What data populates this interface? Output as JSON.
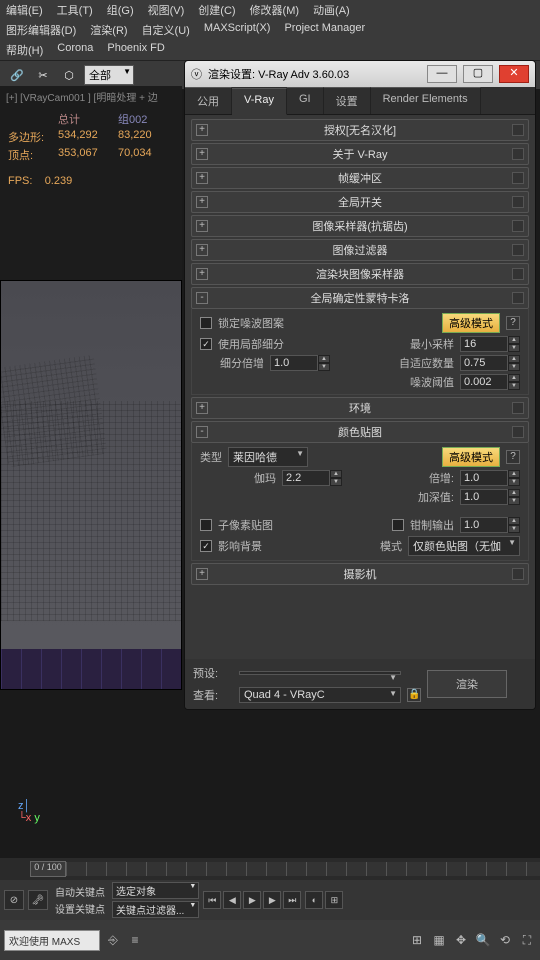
{
  "menu": {
    "row1": [
      "编辑(E)",
      "工具(T)",
      "组(G)",
      "视图(V)",
      "创建(C)",
      "修改器(M)",
      "动画(A)"
    ],
    "row2": [
      "图形编辑器(D)",
      "渲染(R)",
      "自定义(U)",
      "MAXScript(X)",
      "Project Manager"
    ],
    "row3": [
      "帮助(H)",
      "Corona",
      "Phoenix FD"
    ]
  },
  "toolbar": {
    "dropdown": "全部"
  },
  "viewport": {
    "cam": "[+] [VRayCam001 ] [明暗处理 + 边",
    "stats": {
      "h_total": "总计",
      "h_sub": "组002",
      "poly_lab": "多边形:",
      "poly_t": "534,292",
      "poly_s": "83,220",
      "vert_lab": "顶点:",
      "vert_t": "353,067",
      "vert_s": "70,034"
    },
    "fps_lab": "FPS:",
    "fps_val": "0.239"
  },
  "dialog": {
    "title": "渲染设置: V-Ray Adv 3.60.03",
    "tabs": [
      "公用",
      "V-Ray",
      "GI",
      "设置",
      "Render Elements"
    ],
    "active_tab": 1,
    "rollouts_collapsed": [
      "授权[无名汉化]",
      "关于 V-Ray",
      "帧缓冲区",
      "全局开关",
      "图像采样器(抗锯齿)",
      "图像过滤器",
      "渲染块图像采样器"
    ],
    "dmc": {
      "title": "全局确定性蒙特卡洛",
      "lock": "锁定噪波图案",
      "adv_btn": "高级模式",
      "use_local": "使用局部细分",
      "min_lab": "最小采样",
      "min_val": "16",
      "subdiv_lab": "细分倍增",
      "subdiv_val": "1.0",
      "adapt_lab": "自适应数量",
      "adapt_val": "0.75",
      "noise_lab": "噪波阈值",
      "noise_val": "0.002"
    },
    "env": {
      "title": "环境"
    },
    "cmap": {
      "title": "颜色贴图",
      "type_lab": "类型",
      "type_val": "莱因哈德",
      "adv_btn": "高级模式",
      "gamma_lab": "伽玛",
      "gamma_val": "2.2",
      "mult_lab": "倍增:",
      "mult_val": "1.0",
      "burn_lab": "加深值:",
      "burn_val": "1.0",
      "sub_lab": "子像素贴图",
      "clamp_lab": "钳制输出",
      "clamp_val": "1.0",
      "affect_lab": "影响背景",
      "mode_lab": "模式",
      "mode_val": "仅颜色贴图（无伽"
    },
    "camera": {
      "title": "摄影机"
    },
    "preset_lab": "预设:",
    "preset_val": "",
    "view_lab": "查看:",
    "view_val": "Quad 4 - VRayC",
    "render_btn": "渲染"
  },
  "timeline": {
    "scrub": "0 / 100",
    "end": "100"
  },
  "bottom": {
    "autokey": "自动关键点",
    "setkey": "设置关键点",
    "sel": "选定对象",
    "filter": "关键点过滤器..."
  },
  "status": {
    "welcome": "欢迎使用  MAXS"
  }
}
